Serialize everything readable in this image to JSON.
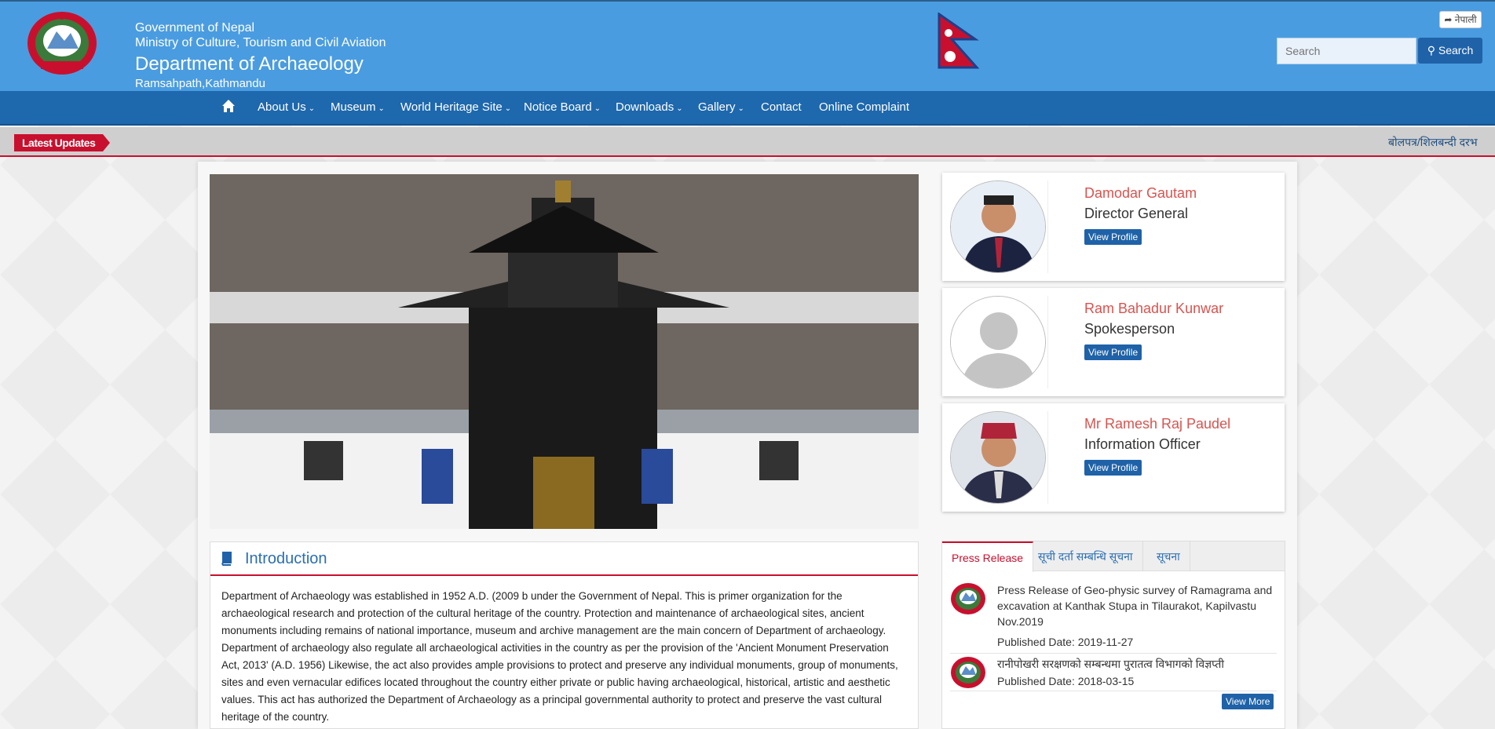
{
  "header": {
    "gov_line1": "Government of Nepal",
    "gov_line2": "Ministry of Culture, Tourism and Civil Aviation",
    "dept_name": "Department of Archaeology",
    "address": "Ramsahpath,Kathmandu",
    "lang_switch": "नेपाली",
    "search_placeholder": "Search",
    "search_button": "Search"
  },
  "nav": {
    "items": [
      "About Us",
      "Museum",
      "World Heritage Site",
      "Notice Board",
      "Downloads",
      "Gallery",
      "Contact",
      "Online Complaint"
    ]
  },
  "ticker": {
    "label": "Latest Updates",
    "text": "बोलपत्र/शिलबन्दी दरभ"
  },
  "intro": {
    "title": "Introduction",
    "body": "Department of Archaeology was established in 1952 A.D. (2009 b under the Government of Nepal. This is primer organization for the archaeological research and protection of the cultural heritage of the country. Protection and maintenance of archaeological sites, ancient monuments including remains of national importance, museum and archive management are the main concern of Department of archaeology. Department of archaeology also regulate all archaeological activities in the country as per the provision of the 'Ancient Monument Preservation Act, 2013' (A.D. 1956) Likewise, the act also provides ample provisions to protect and preserve any individual monuments, group of monuments, sites and even vernacular edifices located throughout the country either private or public having archaeological, historical, artistic and aesthetic values. This act has authorized the Department of Archaeology as a principal governmental authority to protect and preserve the vast cultural heritage of the country."
  },
  "people": [
    {
      "name": "Damodar Gautam",
      "role": "Director General",
      "button": "View Profile"
    },
    {
      "name": "Ram Bahadur Kunwar",
      "role": "Spokesperson",
      "button": "View Profile"
    },
    {
      "name": "Mr Ramesh Raj Paudel",
      "role": "Information Officer",
      "button": "View Profile"
    }
  ],
  "press": {
    "tabs": [
      "Press Release",
      "सूची दर्ता सम्बन्धि सूचना",
      "सूचना"
    ],
    "items": [
      {
        "title": "Press Release of Geo-physic survey of Ramagrama and excavation at Kanthak Stupa in Tilaurakot, Kapilvastu Nov.2019",
        "date": "Published Date: 2019-11-27"
      },
      {
        "title": "रानीपोखरी सरक्षणको सम्बन्धमा पुरातत्व विभागको विज्ञप्ती",
        "date": "Published Date: 2018-03-15"
      }
    ],
    "view_more": "View More"
  },
  "colors": {
    "header_bg": "#4a9ce0",
    "nav_bg": "#1e68ad",
    "accent_red": "#c8102e",
    "button_blue": "#1f62a8"
  }
}
